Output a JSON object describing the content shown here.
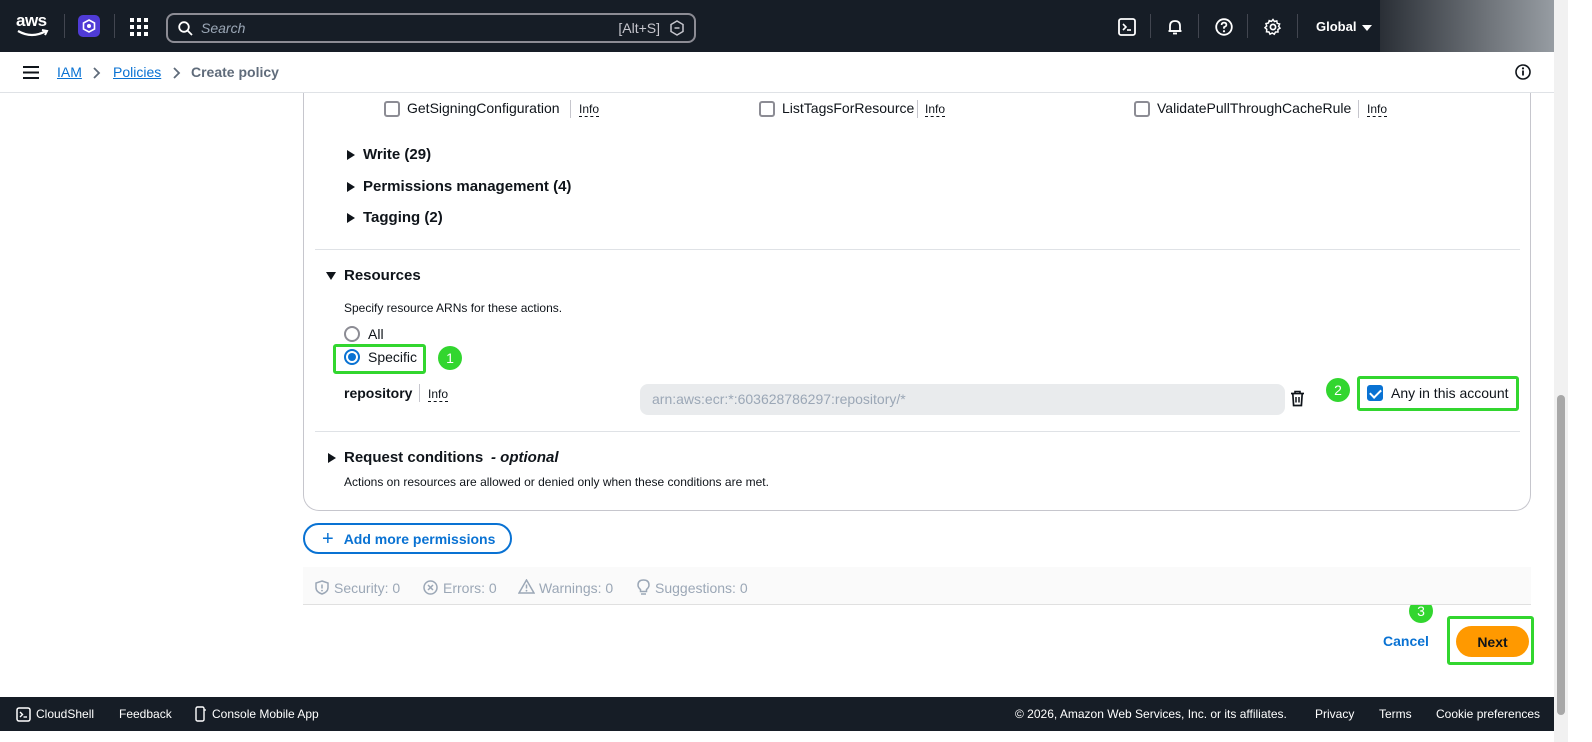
{
  "topnav": {
    "logo_text": "aws",
    "search_placeholder": "Search",
    "search_shortcut": "[Alt+S]",
    "region": "Global"
  },
  "breadcrumb": {
    "items": [
      "IAM",
      "Policies"
    ],
    "current": "Create policy"
  },
  "read_actions": [
    {
      "label": "GetSigningConfiguration",
      "info": "Info",
      "checked": false
    },
    {
      "label": "ListTagsForResource",
      "info": "Info",
      "checked": false
    },
    {
      "label": "ValidatePullThroughCacheRule",
      "info": "Info",
      "checked": false
    }
  ],
  "access_groups": [
    {
      "label": "Write (29)"
    },
    {
      "label": "Permissions management (4)"
    },
    {
      "label": "Tagging (2)"
    }
  ],
  "resources": {
    "title": "Resources",
    "description": "Specify resource ARNs for these actions.",
    "options": [
      "All",
      "Specific"
    ],
    "selected": "Specific",
    "resource_type": "repository",
    "info": "Info",
    "arn_placeholder": "arn:aws:ecr:*:603628786297:repository/*",
    "any_in_account_label": "Any in this account",
    "any_in_account_checked": true
  },
  "request_conditions": {
    "title": "Request conditions",
    "optional": "- optional",
    "description": "Actions on resources are allowed or denied only when these conditions are met."
  },
  "add_permissions_label": "Add more permissions",
  "status": {
    "security": "Security: 0",
    "errors": "Errors: 0",
    "warnings": "Warnings: 0",
    "suggestions": "Suggestions: 0"
  },
  "actions": {
    "cancel": "Cancel",
    "next": "Next"
  },
  "annotations": [
    "1",
    "2",
    "3"
  ],
  "footer": {
    "cloudshell": "CloudShell",
    "feedback": "Feedback",
    "mobile_app": "Console Mobile App",
    "copyright": "© 2026, Amazon Web Services, Inc. or its affiliates.",
    "privacy": "Privacy",
    "terms": "Terms",
    "cookies": "Cookie preferences"
  },
  "colors": {
    "nav_bg": "#161d26",
    "link": "#0972d3",
    "primary_button": "#ff9900",
    "highlight": "#32d62f"
  }
}
